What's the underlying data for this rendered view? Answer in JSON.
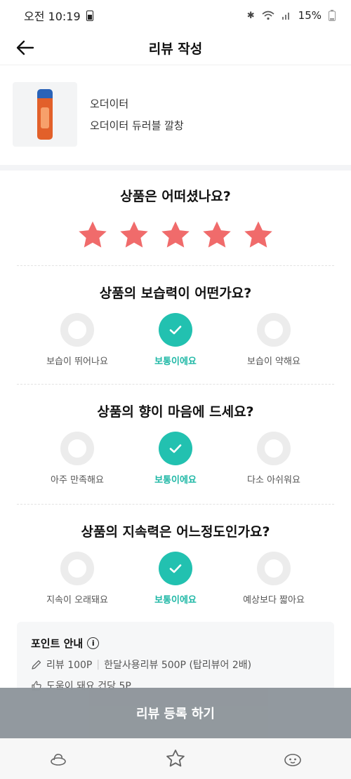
{
  "status": {
    "time": "오전 10:19",
    "battery": "15%"
  },
  "header": {
    "title": "리뷰 작성"
  },
  "product": {
    "brand": "오더이터",
    "name": "오더이터 듀러블 깔창"
  },
  "rating": {
    "question": "상품은 어떠셨나요?",
    "stars": 5,
    "max": 5,
    "star_color": "#f06b6b"
  },
  "accent_color": "#22c1b0",
  "questions": [
    {
      "question": "상품의 보습력이 어떤가요?",
      "options": [
        "보습이 뛰어나요",
        "보통이에요",
        "보습이 약해요"
      ],
      "selected": 1
    },
    {
      "question": "상품의 향이 마음에 드세요?",
      "options": [
        "아주 만족해요",
        "보통이에요",
        "다소 아쉬워요"
      ],
      "selected": 1
    },
    {
      "question": "상품의 지속력은 어느정도인가요?",
      "options": [
        "지속이 오래돼요",
        "보통이에요",
        "예상보다 짧아요"
      ],
      "selected": 1
    }
  ],
  "points": {
    "title": "포인트 안내",
    "review": "리뷰 100P",
    "month": "한달사용리뷰 500P (탑리뷰어 2배)",
    "helpful": "도움이 돼요 건당 5P"
  },
  "register_button": "리뷰 등록 하기"
}
